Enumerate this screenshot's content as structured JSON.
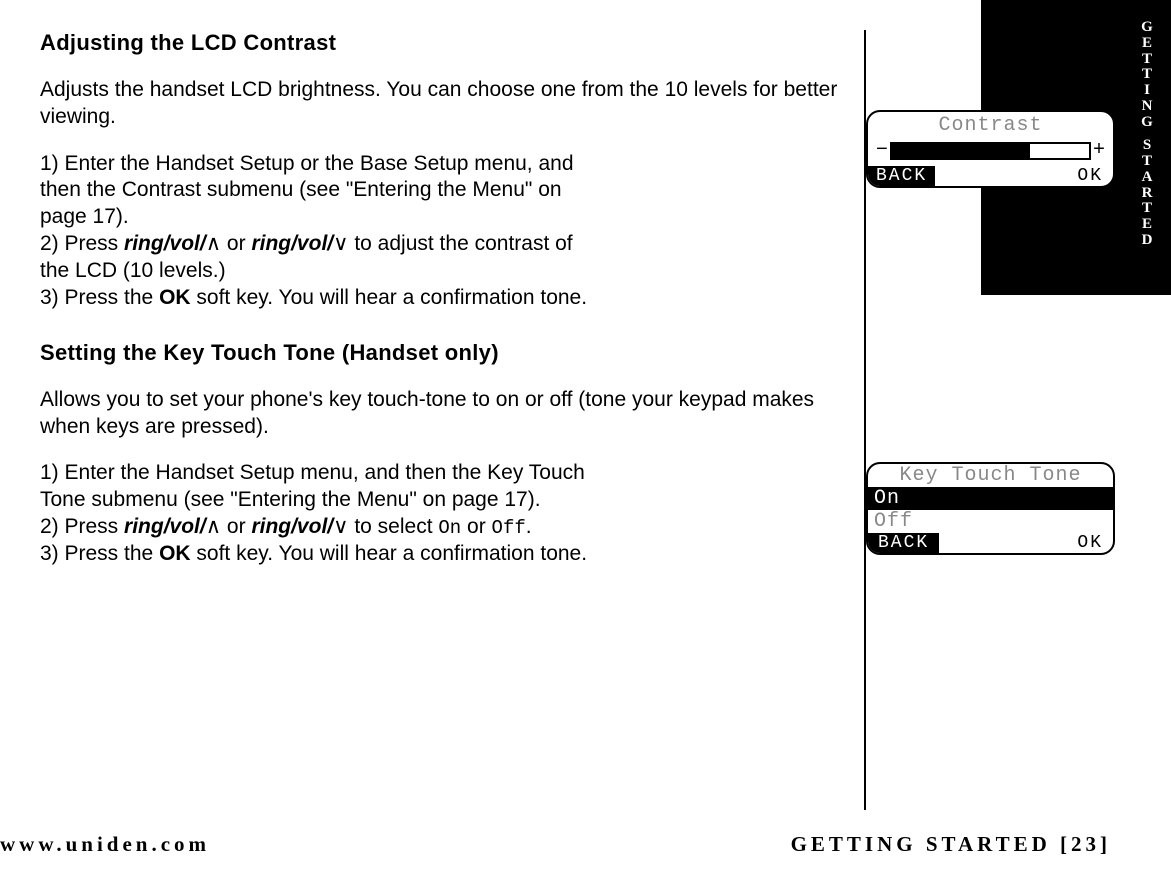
{
  "sideTab": "GETTING STARTED",
  "footer": {
    "url": "www.uniden.com",
    "section": "GETTING STARTED [23]"
  },
  "sec1": {
    "heading": "Adjusting the LCD Contrast",
    "intro": "Adjusts the handset LCD brightness. You can choose one from the 10 levels for better viewing.",
    "s1a": "1) Enter the Handset Setup or the Base Setup menu, and then the Contrast submenu (see \"Entering the Menu\" on page 17).",
    "s2pre": "2) Press ",
    "ringvol": "ring/vol/",
    "or": " or ",
    "s2post": " to adjust the contrast of the LCD (10 levels.)",
    "s3pre": "3) Press the ",
    "ok": "OK",
    "s3post": " soft key. You will hear a confirmation tone."
  },
  "sec2": {
    "heading": "Setting the Key Touch Tone (Handset only)",
    "intro": "Allows you to set your phone's key touch-tone to on or off (tone your keypad makes when keys are pressed).",
    "s1": "1) Enter the Handset Setup menu, and then the Key Touch Tone submenu (see \"Entering the Menu\" on page 17).",
    "s2pre": "2) Press ",
    "s2mid": " to select ",
    "on": "On",
    "orPlain": " or ",
    "off": "Off",
    "period": ".",
    "s3pre": "3) Press the ",
    "s3post": " soft key. You will hear a confirmation tone."
  },
  "lcd1": {
    "title": "Contrast",
    "minus": "−",
    "plus": "+",
    "back": "BACK",
    "ok": "OK"
  },
  "lcd2": {
    "title": "Key Touch Tone",
    "on": "On",
    "off": "Off",
    "back": "BACK",
    "ok": "OK"
  }
}
